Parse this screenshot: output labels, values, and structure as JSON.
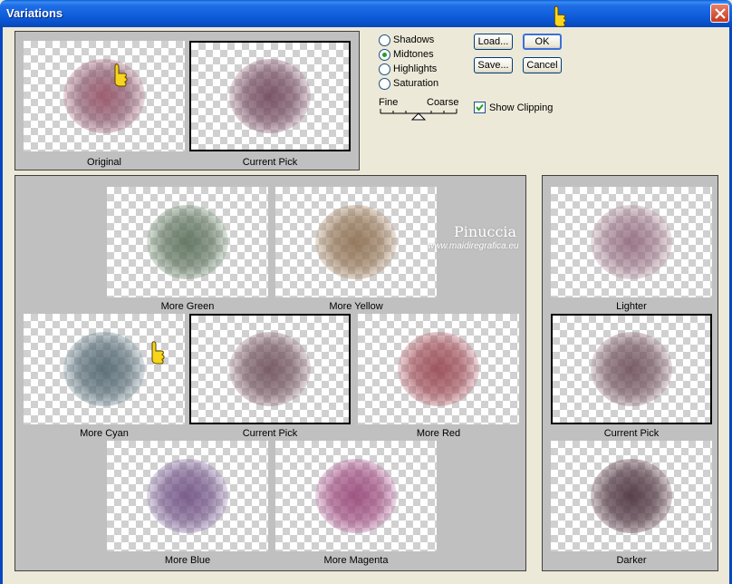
{
  "window": {
    "title": "Variations"
  },
  "tone_options": [
    {
      "label": "Shadows",
      "checked": false
    },
    {
      "label": "Midtones",
      "checked": true
    },
    {
      "label": "Highlights",
      "checked": false
    },
    {
      "label": "Saturation",
      "checked": false
    }
  ],
  "slider": {
    "left_label": "Fine",
    "right_label": "Coarse",
    "level": 0.5
  },
  "buttons": {
    "load": "Load...",
    "ok": "OK",
    "save": "Save...",
    "cancel": "Cancel"
  },
  "show_clipping": {
    "label": "Show Clipping",
    "checked": true
  },
  "top_previews": {
    "original": "Original",
    "current_pick": "Current Pick"
  },
  "variations": {
    "more_green": "More Green",
    "more_yellow": "More Yellow",
    "more_cyan": "More Cyan",
    "current_pick": "Current Pick",
    "more_red": "More Red",
    "more_blue": "More Blue",
    "more_magenta": "More Magenta"
  },
  "brightness": {
    "lighter": "Lighter",
    "current_pick": "Current Pick",
    "darker": "Darker"
  },
  "watermark": {
    "name": "Pinuccia",
    "url": "www.maidiregrafica.eu"
  },
  "colors": {
    "title_bar": "#0b58d6",
    "dialog_bg": "#ece9d8",
    "panel_bg": "#c0c0c0",
    "checker": "#d0d0d0"
  }
}
